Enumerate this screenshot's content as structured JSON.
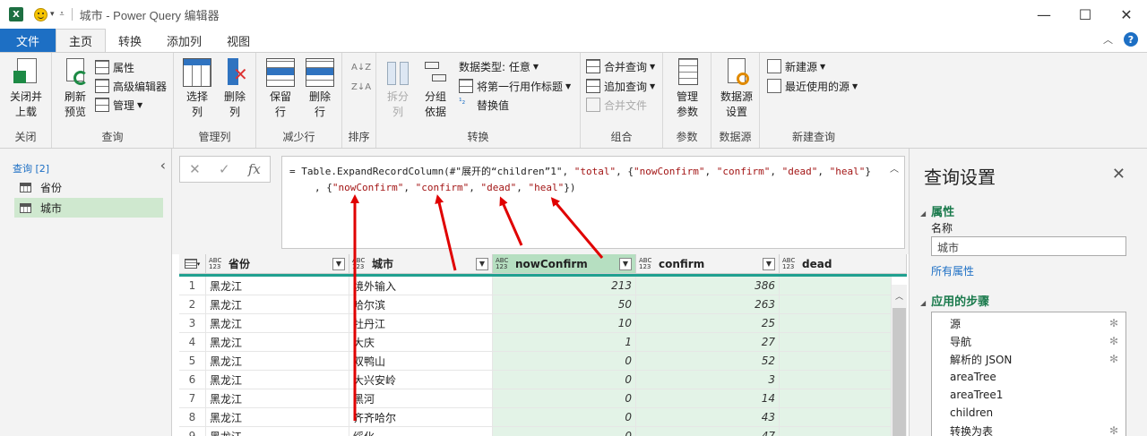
{
  "titlebar": {
    "app_icon": "X",
    "title": "城市 - Power Query 编辑器",
    "minimize": "—",
    "maximize": "☐",
    "close": "✕"
  },
  "tabs": [
    {
      "label": "文件"
    },
    {
      "label": "主页"
    },
    {
      "label": "转换"
    },
    {
      "label": "添加列"
    },
    {
      "label": "视图"
    }
  ],
  "ribbon": {
    "close_group": {
      "btn": "关闭并\n上载",
      "label": "关闭"
    },
    "query_group": {
      "refresh": "刷新\n预览",
      "properties": "属性",
      "advanced_editor": "高级编辑器",
      "manage": "管理",
      "label": "查询"
    },
    "manage_columns": {
      "choose": "选择\n列",
      "remove": "删除\n列",
      "label": "管理列"
    },
    "reduce_rows": {
      "keep": "保留\n行",
      "remove": "删除\n行",
      "label": "减少行"
    },
    "sort": {
      "label": "排序"
    },
    "transform": {
      "split": "拆分\n列",
      "group_by": "分组\n依据",
      "data_type": "数据类型: 任意",
      "first_row_header": "将第一行用作标题",
      "replace_values": "替换值",
      "label": "转换"
    },
    "combine": {
      "merge": "合并查询",
      "append": "追加查询",
      "combine_files": "合并文件",
      "label": "组合"
    },
    "params": {
      "manage": "管理\n参数",
      "label": "参数"
    },
    "datasource": {
      "settings": "数据源\n设置",
      "label": "数据源"
    },
    "new_query": {
      "new_source": "新建源",
      "recent": "最近使用的源",
      "label": "新建查询"
    }
  },
  "queries": {
    "header": "查询 [2]",
    "items": [
      "省份",
      "城市"
    ]
  },
  "formula": {
    "line1_prefix": "= Table.ExpandRecordColumn(#\"展开的“children”1\", ",
    "line1_s1": "\"total\"",
    "line1_mid": ", {",
    "line1_s2": "\"nowConfirm\"",
    "line1_c1": ", ",
    "line1_s3": "\"confirm\"",
    "line1_c2": ", ",
    "line1_s4": "\"dead\"",
    "line1_c3": ", ",
    "line1_s5": "\"heal\"",
    "line1_end": "}",
    "line2_prefix": ", {",
    "line2_s1": "\"nowConfirm\"",
    "line2_c1": ", ",
    "line2_s2": "\"confirm\"",
    "line2_c2": ", ",
    "line2_s3": "\"dead\"",
    "line2_c3": ", ",
    "line2_s4": "\"heal\"",
    "line2_end": "})"
  },
  "grid": {
    "type_icon": "ABC\n123",
    "columns": [
      "省份",
      "城市",
      "nowConfirm",
      "confirm",
      "dead"
    ],
    "rows": [
      [
        "1",
        "黑龙江",
        "境外输入",
        "213",
        "386"
      ],
      [
        "2",
        "黑龙江",
        "哈尔滨",
        "50",
        "263"
      ],
      [
        "3",
        "黑龙江",
        "牡丹江",
        "10",
        "25"
      ],
      [
        "4",
        "黑龙江",
        "大庆",
        "1",
        "27"
      ],
      [
        "5",
        "黑龙江",
        "双鸭山",
        "0",
        "52"
      ],
      [
        "6",
        "黑龙江",
        "大兴安岭",
        "0",
        "3"
      ],
      [
        "7",
        "黑龙江",
        "黑河",
        "0",
        "14"
      ],
      [
        "8",
        "黑龙江",
        "齐齐哈尔",
        "0",
        "43"
      ],
      [
        "9",
        "黑龙江",
        "绥化",
        "0",
        "47"
      ]
    ]
  },
  "settings": {
    "title": "查询设置",
    "properties": "属性",
    "name_label": "名称",
    "name_value": "城市",
    "all_props": "所有属性",
    "steps_header": "应用的步骤",
    "steps": [
      "源",
      "导航",
      "解析的 JSON",
      "areaTree",
      "areaTree1",
      "children",
      "转换为表"
    ]
  },
  "colors": {
    "accent": "#1d6fc4",
    "highlight_col": "#b6dfc1",
    "arrow": "#e00000"
  }
}
